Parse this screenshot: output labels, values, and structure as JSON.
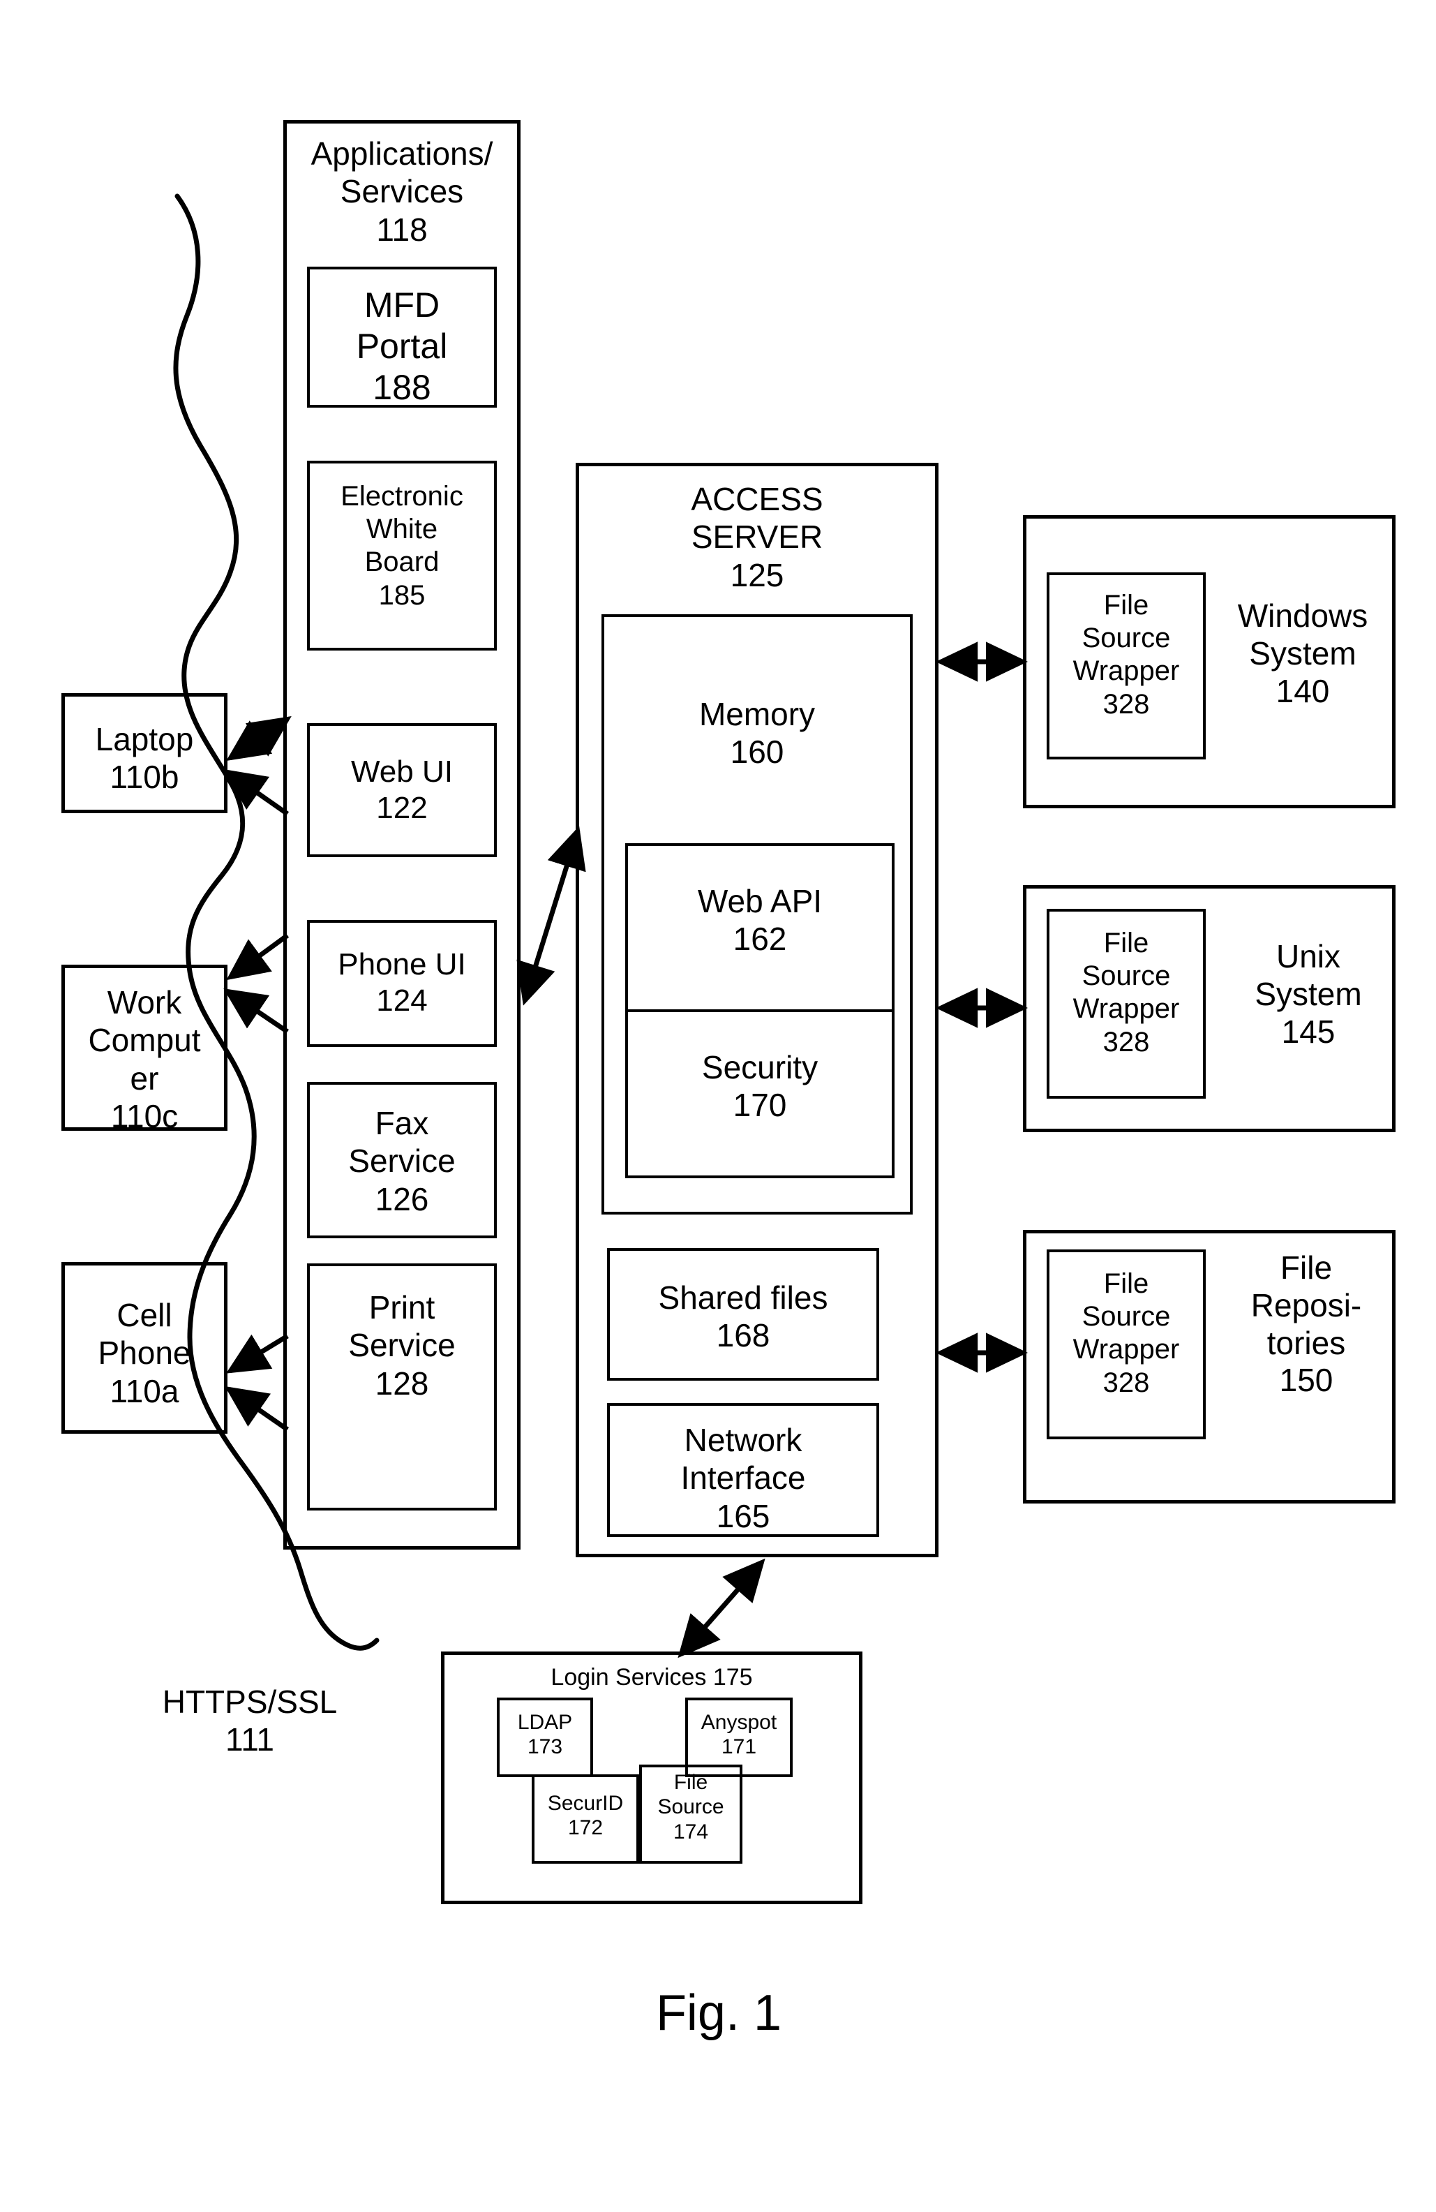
{
  "figure": {
    "caption": "Fig. 1"
  },
  "clients": {
    "items": [
      {
        "name": "laptop",
        "label": "Laptop\n110b"
      },
      {
        "name": "work-computer",
        "label": "Work\nComput\ner\n110c"
      },
      {
        "name": "cell-phone",
        "label": "Cell\nPhone\n110a"
      }
    ]
  },
  "network": {
    "label": "HTTPS/SSL\n111"
  },
  "applications": {
    "title": "Applications/\nServices\n118",
    "items": [
      {
        "name": "mfd-portal",
        "label": "MFD\nPortal\n188"
      },
      {
        "name": "electronic-white-board",
        "label": "Electronic\nWhite\nBoard\n185"
      },
      {
        "name": "web-ui",
        "label": "Web UI\n122"
      },
      {
        "name": "phone-ui",
        "label": "Phone UI\n124"
      },
      {
        "name": "fax-service",
        "label": "Fax\nService\n126"
      },
      {
        "name": "print-service",
        "label": "Print\nService\n128"
      }
    ]
  },
  "access_server": {
    "title": "ACCESS\nSERVER\n125",
    "memory": {
      "title": "Memory\n160",
      "web_api": "Web API\n162",
      "security": "Security\n170"
    },
    "shared_files": "Shared files\n168",
    "network_interface": "Network\nInterface\n165"
  },
  "file_systems": [
    {
      "name": "windows-system",
      "wrapper": "File\nSource\nWrapper\n328",
      "label": "Windows\nSystem\n140"
    },
    {
      "name": "unix-system",
      "wrapper": "File\nSource\nWrapper\n328",
      "label": "Unix\nSystem\n145"
    },
    {
      "name": "file-repositories",
      "wrapper": "File\nSource\nWrapper\n328",
      "label": "File\nReposi-\ntories\n150"
    }
  ],
  "login_services": {
    "title": "Login Services 175",
    "items": [
      {
        "name": "ldap",
        "label": "LDAP\n173"
      },
      {
        "name": "anyspot",
        "label": "Anyspot\n171"
      },
      {
        "name": "securid",
        "label": "SecurID\n172"
      },
      {
        "name": "file-source",
        "label": "File\nSource\n174"
      }
    ]
  },
  "colors": {
    "stroke": "#000000",
    "background": "#ffffff"
  }
}
